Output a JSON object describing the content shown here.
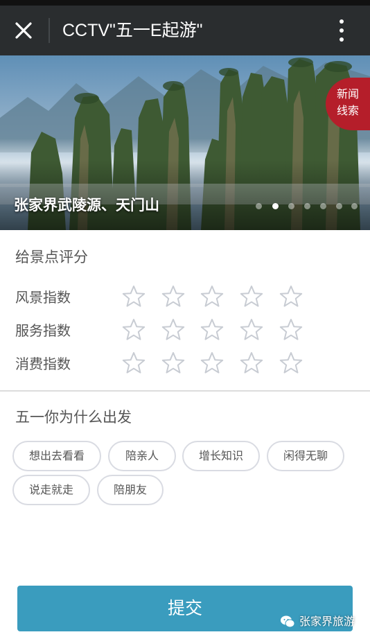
{
  "header": {
    "title": "CCTV\"五一E起游\""
  },
  "banner": {
    "caption": "张家界武陵源、天门山",
    "badge_line1": "新闻",
    "badge_line2": "线索",
    "slide_count": 7,
    "active_slide": 2
  },
  "rating": {
    "title": "给景点评分",
    "rows": [
      {
        "label": "风景指数",
        "stars": 0,
        "max_stars": 5
      },
      {
        "label": "服务指数",
        "stars": 0,
        "max_stars": 5
      },
      {
        "label": "消费指数",
        "stars": 0,
        "max_stars": 5
      }
    ]
  },
  "reasons": {
    "title": "五一你为什么出发",
    "tags": [
      "想出去看看",
      "陪亲人",
      "增长知识",
      "闲得无聊",
      "说走就走",
      "陪朋友"
    ]
  },
  "footer": {
    "submit_label": "提交",
    "watermark": "张家界旅游"
  },
  "colors": {
    "titlebar": "#2a2d2f",
    "submit": "#3a9cbe",
    "badge": "#b51e2a",
    "star_outline": "#c8ccd3"
  }
}
